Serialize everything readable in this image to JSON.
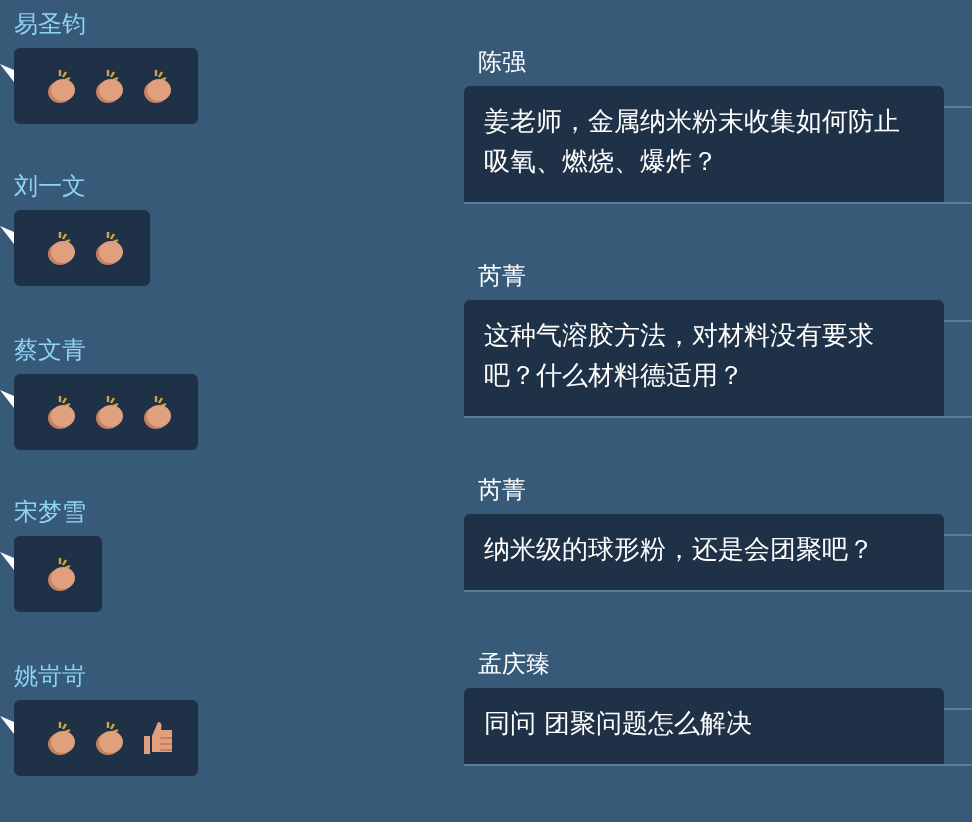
{
  "reactions": [
    {
      "name": "易圣钧",
      "emojis": [
        {
          "kind": "clap"
        },
        {
          "kind": "clap"
        },
        {
          "kind": "clap"
        }
      ]
    },
    {
      "name": "刘一文",
      "emojis": [
        {
          "kind": "clap"
        },
        {
          "kind": "clap"
        }
      ]
    },
    {
      "name": "蔡文青",
      "emojis": [
        {
          "kind": "clap"
        },
        {
          "kind": "clap"
        },
        {
          "kind": "clap"
        }
      ]
    },
    {
      "name": "宋梦雪",
      "emojis": [
        {
          "kind": "clap"
        }
      ]
    },
    {
      "name": "姚岢岢",
      "emojis": [
        {
          "kind": "clap"
        },
        {
          "kind": "clap"
        },
        {
          "kind": "thumbs"
        }
      ]
    }
  ],
  "messages": [
    {
      "name": "陈强",
      "text": "姜老师，金属纳米粉末收集如何防止吸氧、燃烧、爆炸？"
    },
    {
      "name": "芮菁",
      "text": "这种气溶胶方法，对材料没有要求吧？什么材料德适用？"
    },
    {
      "name": "芮菁",
      "text": "纳米级的球形粉，还是会团聚吧？"
    },
    {
      "name": "孟庆臻",
      "text": "同问 团聚问题怎么解决"
    }
  ]
}
